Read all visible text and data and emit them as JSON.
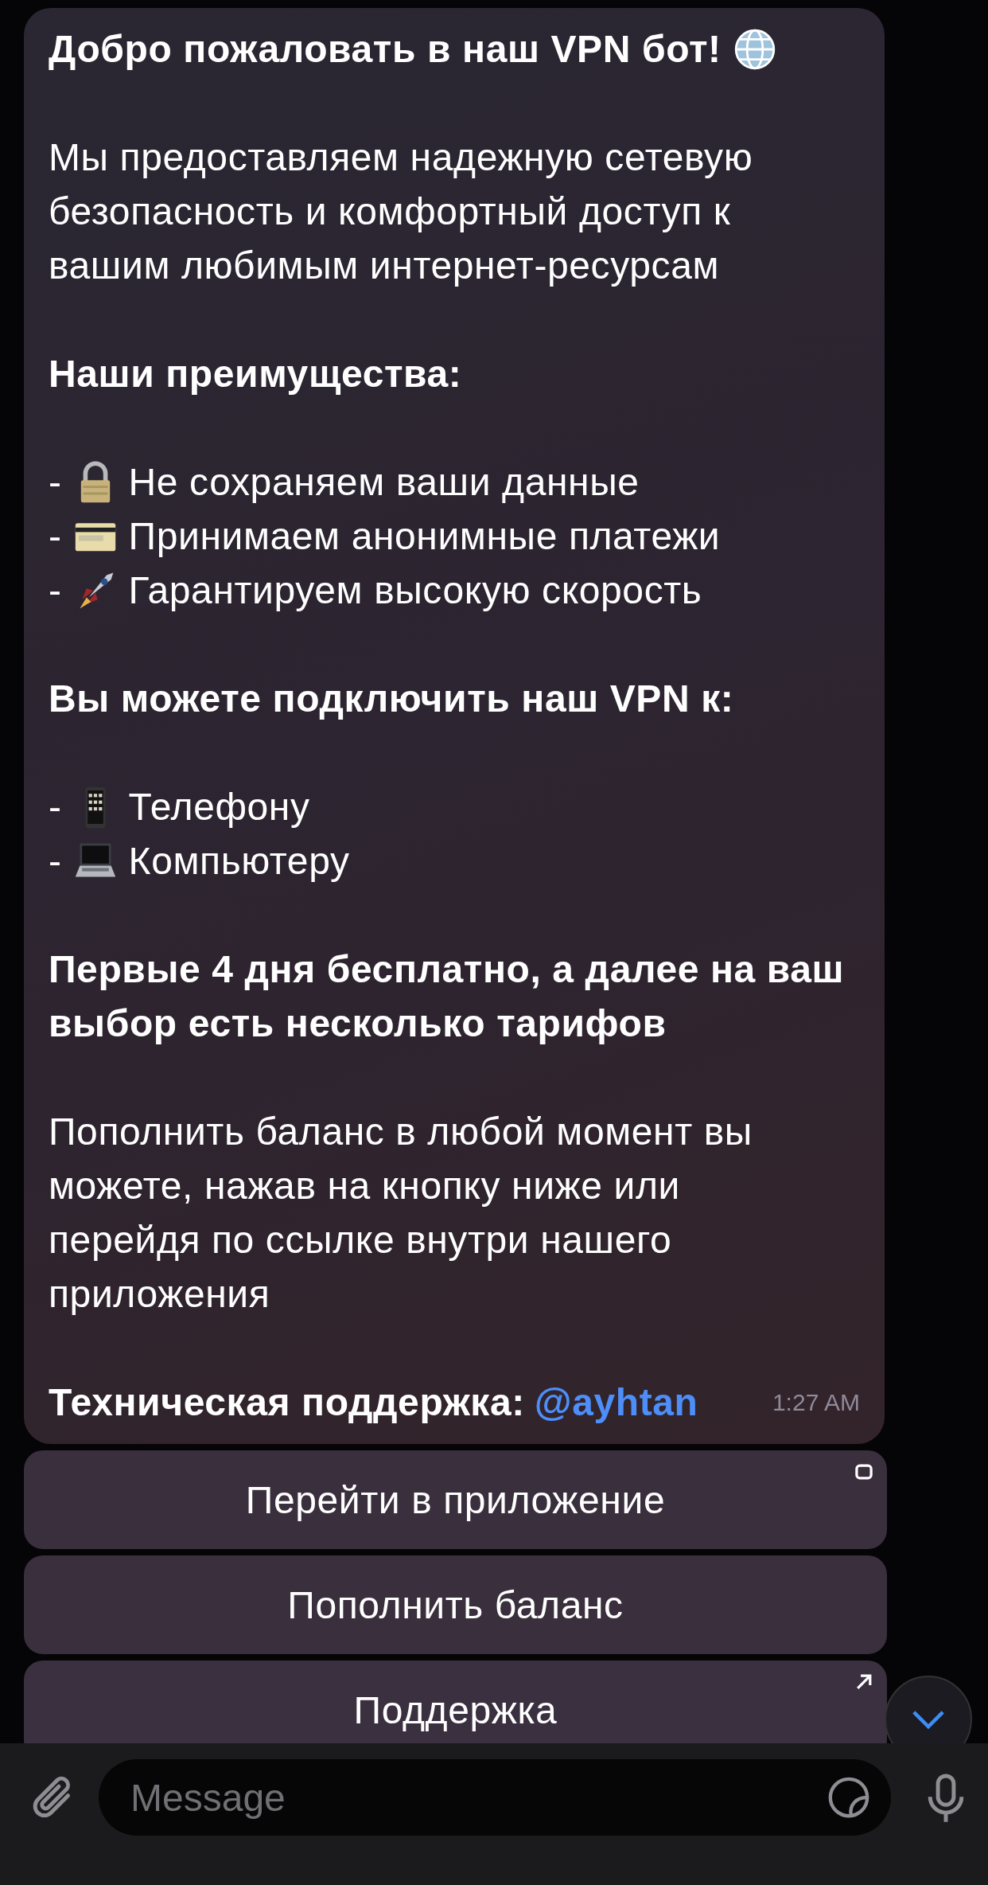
{
  "message": {
    "blocks": [
      {
        "kind": "title",
        "text": "Добро пожаловать в наш VPN бот!"
      },
      {
        "kind": "paragraph",
        "text": "Мы предоставляем надежную сетевую\nбезопасность и комфортный доступ к\nвашим любимым интернет-ресурсам"
      },
      {
        "kind": "heading",
        "text": "Наши преимущества:"
      },
      {
        "kind": "list",
        "items": [
          {
            "bullet": "-",
            "text": "Не сохраняем ваши данные"
          },
          {
            "bullet": "-",
            "text": "Принимаем анонимные платежи"
          },
          {
            "bullet": "-",
            "text": "Гарантируем высокую скорость"
          }
        ]
      },
      {
        "kind": "heading",
        "text": "Вы можете подключить наш VPN к:"
      },
      {
        "kind": "list",
        "items": [
          {
            "bullet": "-",
            "text": "Телефону"
          },
          {
            "bullet": "-",
            "text": "Компьютеру"
          }
        ]
      },
      {
        "kind": "heading",
        "text": "Первые 4 дня бесплатно, а далее на ваш\nвыбор есть несколько тарифов"
      },
      {
        "kind": "paragraph",
        "text": "Пополнить баланс в любой момент вы\nможете, нажав на кнопку ниже или\nперейдя по ссылке внутри нашего\nприложения"
      },
      {
        "kind": "support",
        "label": "Техническая поддержка:",
        "link": "@ayhtan"
      }
    ],
    "time": "1:27 AM"
  },
  "buttons": [
    {
      "kind": "webapp",
      "label": "Перейти в приложение"
    },
    {
      "kind": "callback",
      "label": "Пополнить баланс"
    },
    {
      "kind": "url",
      "label": "Поддержка"
    }
  ],
  "composer": {
    "placeholder": "Message"
  }
}
